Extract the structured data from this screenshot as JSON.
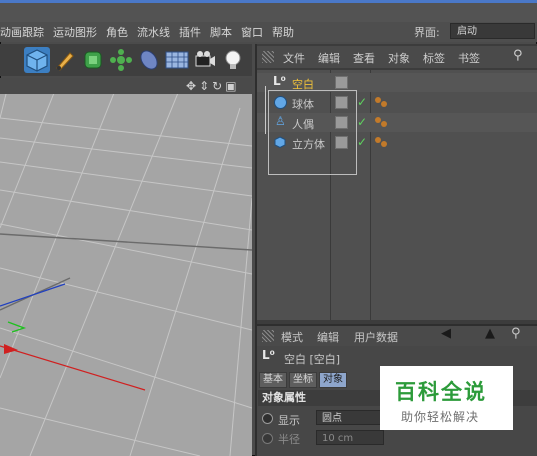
{
  "menu": {
    "items": [
      "动画跟踪",
      "运动图形",
      "角色",
      "流水线",
      "插件",
      "脚本",
      "窗口",
      "帮助"
    ],
    "layout_label": "界面:",
    "layout_value": "启动"
  },
  "toolbar": {
    "tools": [
      "cube-icon",
      "pen-icon",
      "subdivision-icon",
      "cloner-icon",
      "deformer-icon",
      "floor-icon",
      "camera-icon",
      "light-icon"
    ]
  },
  "viewport": {
    "nav_icons": [
      "move-icon",
      "zoom-icon",
      "rotate-icon",
      "maximize-icon"
    ]
  },
  "object_manager": {
    "menu": [
      "文件",
      "编辑",
      "查看",
      "对象",
      "标签",
      "书签"
    ],
    "objects": [
      {
        "name": "空白",
        "icon": "null-icon",
        "selected": true
      },
      {
        "name": "球体",
        "icon": "sphere-icon",
        "selected": false
      },
      {
        "name": "人偶",
        "icon": "figure-icon",
        "selected": false
      },
      {
        "name": "立方体",
        "icon": "cube-icon",
        "selected": false
      }
    ]
  },
  "attributes": {
    "menu": [
      "模式",
      "编辑",
      "用户数据"
    ],
    "object_label": "空白 [空白]",
    "tabs": [
      "基本",
      "坐标",
      "对象"
    ],
    "active_tab": "对象",
    "section_title": "对象属性",
    "display_label": "显示",
    "display_value": "圆点",
    "radius_label": "半径",
    "radius_value": "10 cm"
  },
  "watermark": {
    "title": "百科全说",
    "subtitle": "助你轻松解决"
  },
  "colors": {
    "accent": "#8ea6cc",
    "check": "#5fd35f",
    "tag_dot": "#c27a2a",
    "watermark_green": "#2c9b3a"
  }
}
